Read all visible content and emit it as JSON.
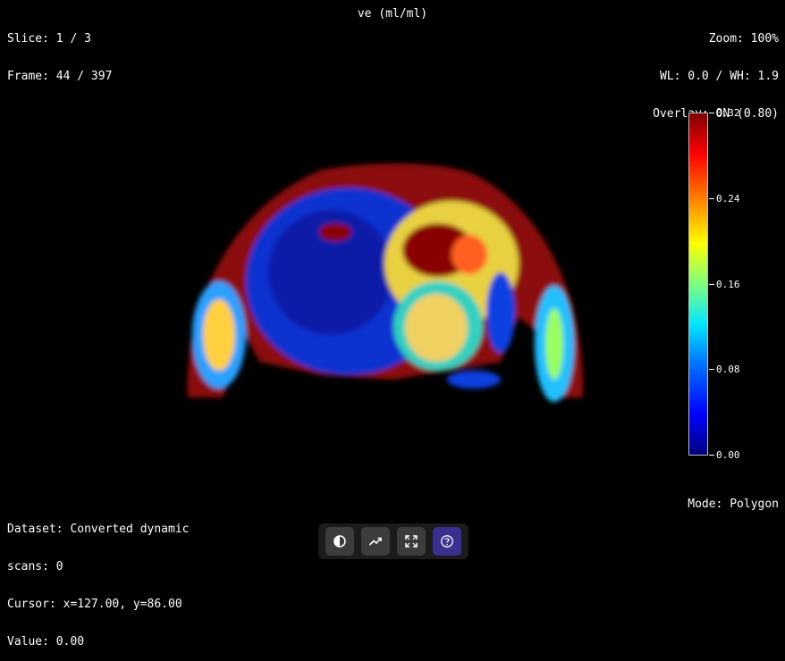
{
  "top_left": {
    "slice": "Slice: 1 / 3",
    "frame": "Frame: 44 / 397"
  },
  "top_center": {
    "title": "ve (ml/ml)"
  },
  "top_right": {
    "zoom": "Zoom: 100%",
    "window": "WL: 0.0 / WH: 1.9",
    "overlay": "Overlay: ON (0.80)"
  },
  "colorbar": {
    "ticks": [
      "0.32",
      "0.24",
      "0.16",
      "0.08",
      "0.00"
    ],
    "colormap": "jet"
  },
  "bottom_left": {
    "dataset_line1": "Dataset: Converted dynamic",
    "dataset_line2": "scans: 0",
    "cursor": "Cursor: x=127.00, y=86.00",
    "value": "Value: 0.00"
  },
  "bottom_right": {
    "mode": "Mode: Polygon"
  },
  "toolbar": {
    "buttons": [
      {
        "icon": "contrast-icon"
      },
      {
        "icon": "trend-chart-icon"
      },
      {
        "icon": "fullscreen-icon"
      },
      {
        "icon": "help-icon",
        "active": true
      }
    ]
  },
  "colors": {
    "background": "#000000",
    "toolbar_bg": "#1b1b1b",
    "button_bg": "#3c3c3c",
    "active_button_bg": "#3b2f8f"
  }
}
